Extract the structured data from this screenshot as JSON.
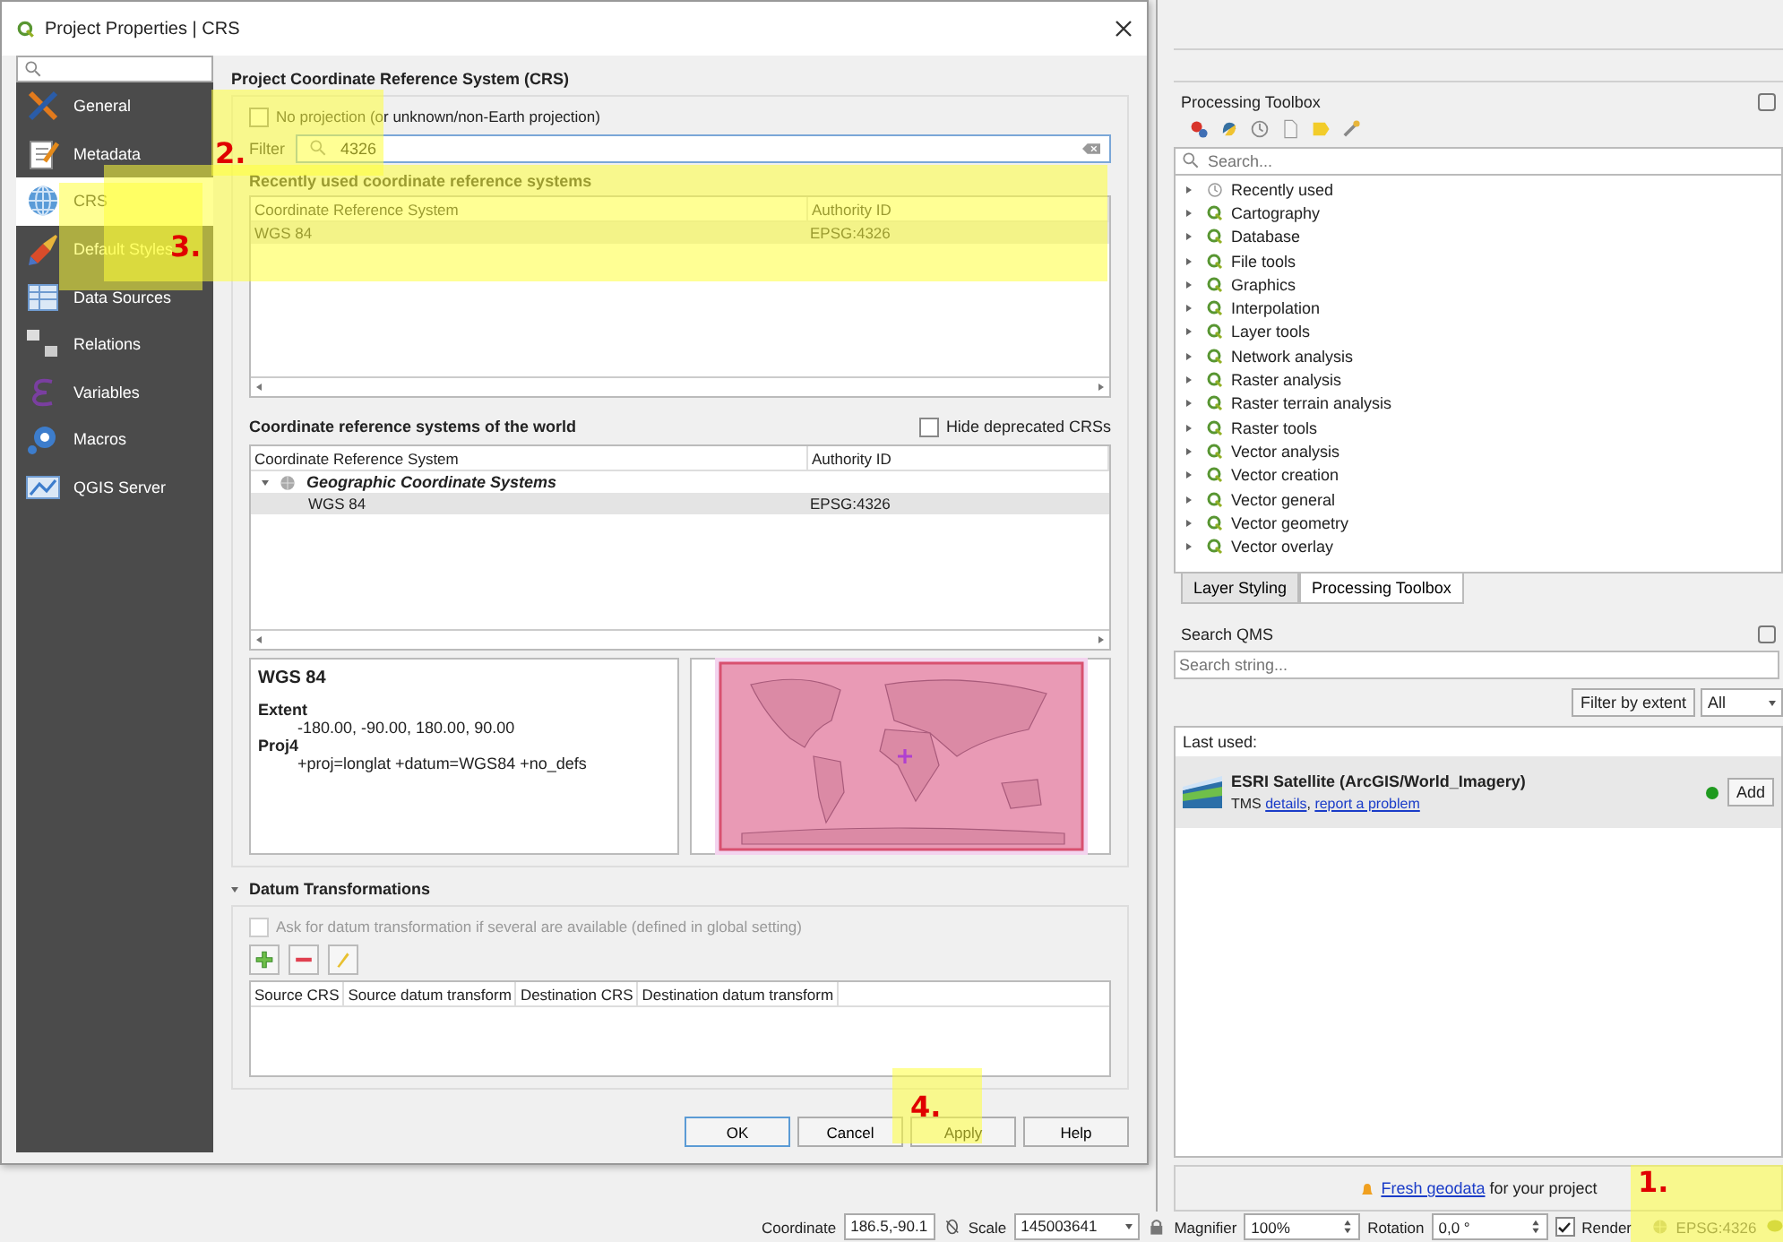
{
  "dialog": {
    "title": "Project Properties | CRS",
    "sidebar_items": [
      {
        "label": "General",
        "selected": false
      },
      {
        "label": "Metadata",
        "selected": false
      },
      {
        "label": "CRS",
        "selected": true
      },
      {
        "label": "Default Styles",
        "selected": false
      },
      {
        "label": "Data Sources",
        "selected": false
      },
      {
        "label": "Relations",
        "selected": false
      },
      {
        "label": "Variables",
        "selected": false
      },
      {
        "label": "Macros",
        "selected": false
      },
      {
        "label": "QGIS Server",
        "selected": false
      }
    ],
    "heading": "Project Coordinate Reference System (CRS)",
    "no_projection": {
      "label": "No projection (or unknown/non-Earth projection)",
      "checked": false
    },
    "filter": {
      "label": "Filter",
      "value": "4326"
    },
    "recent": {
      "heading": "Recently used coordinate reference systems",
      "columns": [
        "Coordinate Reference System",
        "Authority ID"
      ],
      "rows": [
        {
          "cells": [
            "WGS 84",
            "EPSG:4326"
          ],
          "selected": true
        }
      ]
    },
    "world": {
      "heading": "Coordinate reference systems of the world",
      "hide_deprecated": {
        "label": "Hide deprecated CRSs",
        "checked": false
      },
      "columns": [
        "Coordinate Reference System",
        "Authority ID"
      ],
      "tree": [
        {
          "label": "Geographic Coordinate Systems",
          "expanded": true,
          "children": [
            {
              "label": "WGS 84",
              "authority": "EPSG:4326",
              "selected": true
            }
          ]
        }
      ]
    },
    "details": {
      "name": "WGS 84",
      "extent_label": "Extent",
      "extent": "-180.00, -90.00, 180.00, 90.00",
      "proj4_label": "Proj4",
      "proj4": "+proj=longlat +datum=WGS84 +no_defs"
    },
    "datum": {
      "heading": "Datum Transformations",
      "expanded": true,
      "ask": {
        "label": "Ask for datum transformation if several are available (defined in global setting)",
        "checked": false,
        "disabled": true
      },
      "columns": [
        "Source CRS",
        "Source datum transform",
        "Destination CRS",
        "Destination datum transform"
      ]
    },
    "buttons": [
      "OK",
      "Cancel",
      "Apply",
      "Help"
    ]
  },
  "processing_toolbox": {
    "title": "Processing Toolbox",
    "search_placeholder": "Search...",
    "items": [
      {
        "label": "Recently used",
        "kind": "history"
      },
      {
        "label": "Cartography",
        "kind": "provider"
      },
      {
        "label": "Database",
        "kind": "provider"
      },
      {
        "label": "File tools",
        "kind": "provider"
      },
      {
        "label": "Graphics",
        "kind": "provider"
      },
      {
        "label": "Interpolation",
        "kind": "provider"
      },
      {
        "label": "Layer tools",
        "kind": "provider"
      },
      {
        "label": "Network analysis",
        "kind": "provider"
      },
      {
        "label": "Raster analysis",
        "kind": "provider"
      },
      {
        "label": "Raster terrain analysis",
        "kind": "provider"
      },
      {
        "label": "Raster tools",
        "kind": "provider"
      },
      {
        "label": "Vector analysis",
        "kind": "provider"
      },
      {
        "label": "Vector creation",
        "kind": "provider"
      },
      {
        "label": "Vector general",
        "kind": "provider"
      },
      {
        "label": "Vector geometry",
        "kind": "provider"
      },
      {
        "label": "Vector overlay",
        "kind": "provider"
      }
    ]
  },
  "panel_tabs": [
    {
      "label": "Layer Styling",
      "selected": false
    },
    {
      "label": "Processing Toolbox",
      "selected": true
    }
  ],
  "qms": {
    "title": "Search QMS",
    "search_placeholder": "Search string...",
    "filter_button": "Filter by extent",
    "scope": "All",
    "last_used_label": "Last used:",
    "services": [
      {
        "name": "ESRI Satellite (ArcGIS/World_Imagery)",
        "type": "TMS",
        "links": [
          "details",
          "report a problem"
        ],
        "separator": ",",
        "color": "#1f9a1f",
        "add_label": "Add"
      }
    ],
    "footer": {
      "link": "Fresh geodata",
      "text": "for your project"
    }
  },
  "status_bar": {
    "coordinate_label": "Coordinate",
    "coordinate": "186.5,-90.1",
    "scale_label": "Scale",
    "scale": "145003641",
    "magnifier_label": "Magnifier",
    "magnifier": "100%",
    "rotation_label": "Rotation",
    "rotation": "0,0 °",
    "render": {
      "label": "Render",
      "checked": true
    },
    "crs": "EPSG:4326"
  },
  "annotations": [
    {
      "label": "2."
    },
    {
      "label": "3."
    },
    {
      "label": "4."
    },
    {
      "label": "1."
    }
  ]
}
